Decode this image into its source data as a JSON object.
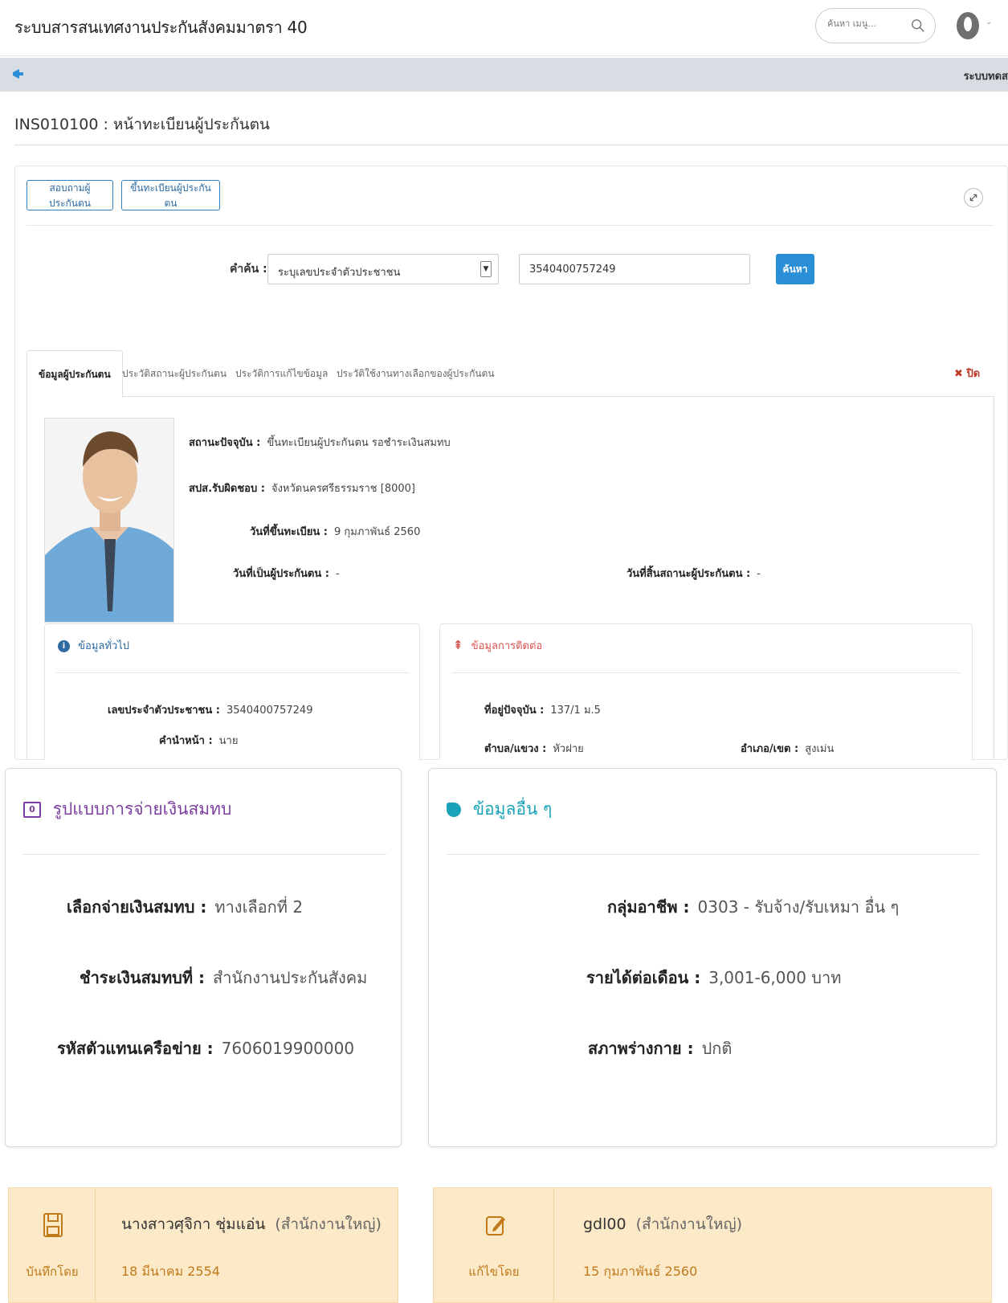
{
  "header": {
    "app_title": "ระบบสารสนเทศงานประกันสังคมมาตรา 40",
    "search_placeholder": "ค้นหา เมนู..."
  },
  "announcement": {
    "text": "ระบบทดส"
  },
  "page": {
    "title": "INS010100 : หน้าทะเบียนผู้ประกันตน"
  },
  "toolbar": {
    "inquiry_label": "สอบถามผู้ประกันตน",
    "register_label": "ขึ้นทะเบียนผู้ประกันตน"
  },
  "search": {
    "label": "คำค้น :",
    "type_selected": "ระบุเลขประจำตัวประชาชน",
    "value": "3540400757249",
    "button_label": "ค้นหา"
  },
  "tabs": [
    {
      "label": "ข้อมูลผู้ประกันตน"
    },
    {
      "label": "ประวัติสถานะผู้ประกันตน"
    },
    {
      "label": "ประวัติการแก้ไขข้อมูล"
    },
    {
      "label": "ประวัติใช้งานทางเลือกของผู้ประกันตน"
    }
  ],
  "close_label": "ปิด",
  "insured": {
    "status_label": "สถานะปัจจุบัน :",
    "status_value": "ขึ้นทะเบียนผู้ประกันตน รอชำระเงินสมทบ",
    "office_label": "สปส.รับผิดชอบ :",
    "office_value": "จังหวัดนครศรีธรรมราช [8000]",
    "reg_date_label": "วันที่ขึ้นทะเบียน :",
    "reg_date_value": "9 กุมภาพันธ์ 2560",
    "insured_date_label": "วันที่เป็นผู้ประกันตน :",
    "insured_date_value": "-",
    "end_date_label": "วันที่สิ้นสถานะผู้ประกันตน :",
    "end_date_value": "-"
  },
  "general": {
    "title": "ข้อมูลทั่วไป",
    "id_label": "เลขประจำตัวประชาชน :",
    "id_value": "3540400757249",
    "prefix_label": "คำนำหน้า :",
    "prefix_value": "นาย"
  },
  "contact": {
    "title": "ข้อมูลการติดต่อ",
    "address_label": "ที่อยู่ปัจจุบัน :",
    "address_value": "137/1 ม.5",
    "subdistrict_label": "ตำบล/แขวง :",
    "subdistrict_value": "หัวฝาย",
    "district_label": "อำเภอ/เขต :",
    "district_value": "สูงเม่น"
  },
  "payment": {
    "title": "รูปแบบการจ่ายเงินสมทบ",
    "option_label": "เลือกจ่ายเงินสมทบ :",
    "option_value": "ทางเลือกที่ 2",
    "place_label": "ชำระเงินสมทบที่ :",
    "place_value": "สำนักงานประกันสังคม",
    "agent_label": "รหัสตัวแทนเครือข่าย :",
    "agent_value": "7606019900000"
  },
  "other": {
    "title": "ข้อมูลอื่น ๆ",
    "occupation_label": "กลุ่มอาชีพ :",
    "occupation_value": "0303  - รับจ้าง/รับเหมา อื่น ๆ",
    "income_label": "รายได้ต่อเดือน :",
    "income_value": "3,001-6,000 บาท",
    "health_label": "สภาพร่างกาย :",
    "health_value": "ปกติ"
  },
  "audit_created": {
    "label": "บันทึกโดย",
    "name": "นางสาวศุจิกา ชุ่มแอ่น",
    "dept": "(สำนักงานใหญ่)",
    "date": "18 มีนาคม 2554"
  },
  "audit_updated": {
    "label": "แก้ไขโดย",
    "name": "gdl00",
    "dept": "(สำนักงานใหญ่)",
    "date": "15 กุมภาพันธ์ 2560"
  },
  "colors": {
    "primary": "#2a8fd6",
    "general_icon": "#2d6aa0",
    "contact_icon": "#d9534f",
    "payment_title": "#7b3fa0",
    "other_title": "#1aa3b8",
    "audit_bg": "#fce9c7",
    "audit_accent": "#c07a1c"
  }
}
